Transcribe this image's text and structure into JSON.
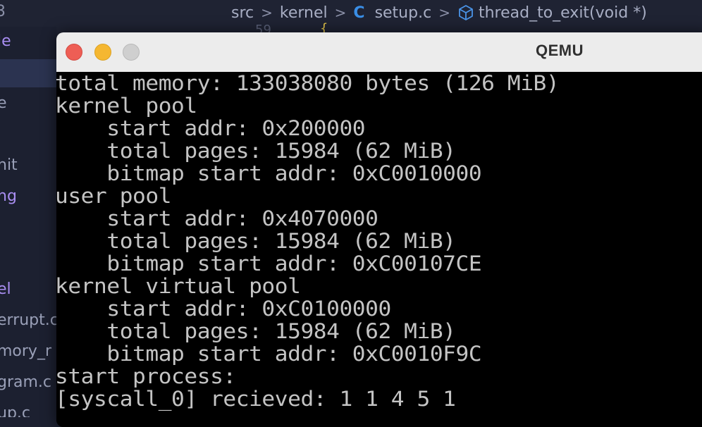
{
  "background": {
    "breadcrumb_partial": "3",
    "breadcrumb": {
      "src": "src",
      "kernel": "kernel",
      "file": "setup.c",
      "symbol": "thread_to_exit(void *)",
      "c_glyph": "C",
      "separator": ">"
    },
    "sidebar_items": [
      "le",
      "e",
      "nit",
      "ng",
      "el",
      "errupt.c",
      "mory_r",
      "gram.c",
      "up.c"
    ],
    "editor_fragment": "59"
  },
  "window": {
    "title": "QEMU",
    "accent_colors": {
      "close": "#ee5e55",
      "minimize": "#f5b731",
      "zoom": "#cfcfcf"
    }
  },
  "console": {
    "lines": [
      "total memory: 133038080 bytes (126 MiB)",
      "kernel pool",
      "    start addr: 0x200000",
      "    total pages: 15984 (62 MiB)",
      "    bitmap start addr: 0xC0010000",
      "user pool",
      "    start addr: 0x4070000",
      "    total pages: 15984 (62 MiB)",
      "    bitmap start addr: 0xC00107CE",
      "kernel virtual pool",
      "    start addr: 0xC0100000",
      "    total pages: 15984 (62 MiB)",
      "    bitmap start addr: 0xC0010F9C",
      "start process:",
      "[syscall_0] recieved: 1 1 4 5 1"
    ]
  }
}
